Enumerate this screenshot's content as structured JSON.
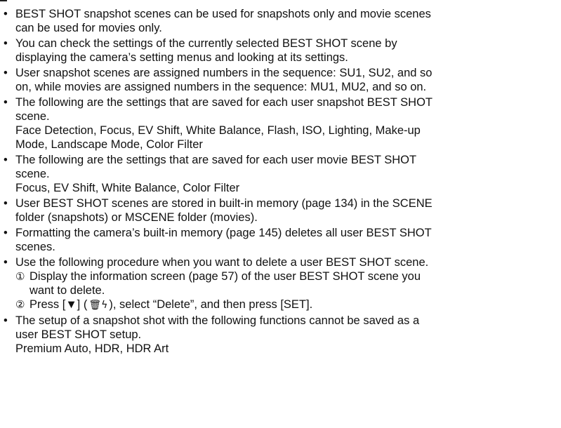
{
  "bullet_char": "•",
  "items": [
    {
      "lines": [
        "BEST SHOT snapshot scenes can be used for snapshots only and movie scenes",
        "can be used for movies only."
      ]
    },
    {
      "lines": [
        "You can check the settings of the currently selected BEST SHOT scene by",
        "displaying the camera’s setting menus and looking at its settings."
      ]
    },
    {
      "lines": [
        "User snapshot scenes are assigned numbers in the sequence: SU1, SU2, and so",
        "on, while movies are assigned numbers in the sequence: MU1, MU2, and so on."
      ]
    },
    {
      "lines": [
        "The following are the settings that are saved for each user snapshot BEST SHOT",
        "scene.",
        "Face Detection, Focus, EV Shift, White Balance, Flash, ISO, Lighting, Make-up",
        "Mode, Landscape Mode, Color Filter"
      ]
    },
    {
      "lines": [
        "The following are the settings that are saved for each user movie BEST SHOT",
        "scene.",
        "Focus, EV Shift, White Balance, Color Filter"
      ]
    },
    {
      "lines": [
        "User BEST SHOT scenes are stored in built-in memory (page 134) in the SCENE",
        "folder (snapshots) or MSCENE folder (movies)."
      ]
    },
    {
      "lines": [
        "Formatting the camera’s built-in memory (page 145) deletes all user BEST SHOT",
        "scenes."
      ]
    },
    {
      "lines": [
        "Use the following procedure when you want to delete a user BEST SHOT scene."
      ]
    },
    {
      "lines": [
        "The setup of a snapshot shot with the following functions cannot be saved as a",
        "user BEST SHOT setup.",
        "Premium Auto, HDR, HDR Art"
      ]
    }
  ],
  "steps": [
    {
      "num": "①",
      "lines": [
        "Display the information screen (page 57) of the user BEST SHOT scene you",
        "want to delete."
      ]
    },
    {
      "num": "②",
      "before": "Press [▼] (",
      "trash_icon": "🗑",
      "flash_icon": "ϟ",
      "after": "), select “Delete”, and then press [SET]."
    }
  ]
}
